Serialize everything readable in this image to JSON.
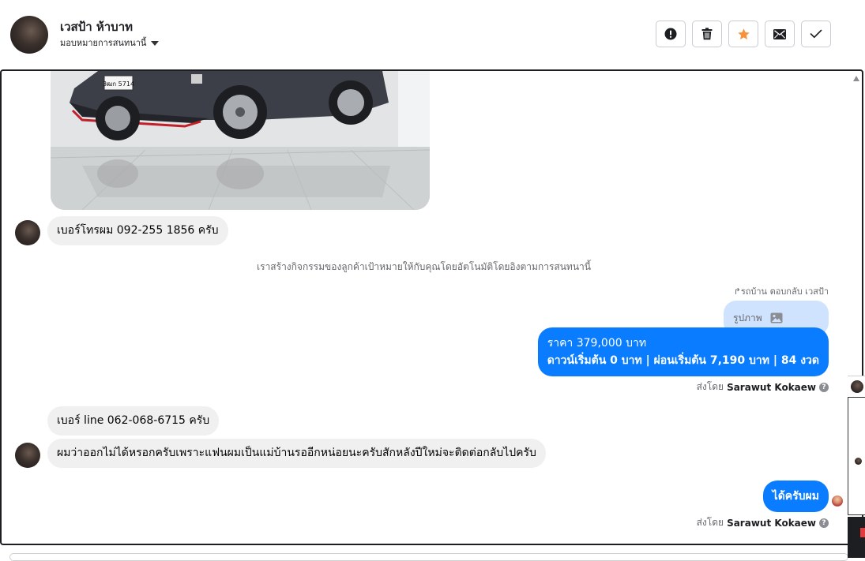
{
  "header": {
    "contact_name": "เวสป้า ห้าบาท",
    "assign_label": "มอบหมายการสนทนานี้",
    "toolbar": [
      {
        "name": "mark-spam-button",
        "icon": "exclamation-icon"
      },
      {
        "name": "delete-button",
        "icon": "trash-icon"
      },
      {
        "name": "star-button",
        "icon": "star-icon"
      },
      {
        "name": "mark-unread-button",
        "icon": "envelope-icon"
      },
      {
        "name": "mark-done-button",
        "icon": "check-icon"
      }
    ]
  },
  "messages": {
    "phone": "เบอร์โทรผม 092-255 1856 ครับ",
    "system_note": "เราสร้างกิจกรรมของลูกค้าเป้าหมายให้กับคุณโดยอัตโนมัติโดยอิงตามการสนทนานี้",
    "reply_context": "รถบ้าน ตอบกลับ เวสป้า",
    "quoted_label": "รูปภาพ",
    "price_line1": "ราคา 379,000 บาท",
    "price_line2": "ดาวน์เริ่มต้น 0 บาท | ผ่อนเริ่มต้น 7,190 บาท | 84 งวด",
    "sent_by_prefix": "ส่งโดย",
    "sent_by_name": "Sarawut Kokaew",
    "line_id": "เบอร์ line 062-068-6715 ครับ",
    "long_msg": "ผมว่าออกไม่ได้หรอกครับเพราะแฟนผมเป็นแม่บ้านรออีกหน่อยนะครับสักหลังปีใหม่จะติดต่อกลับไปครับ",
    "reply_ok": "ได้ครับผม",
    "plate_text": "3ฒก 5714"
  },
  "colors": {
    "outgoing_bubble": "#0a7cff",
    "incoming_bubble": "#f0f0f0",
    "quoted_bubble": "#cfe3ff",
    "star": "#f7923a"
  }
}
